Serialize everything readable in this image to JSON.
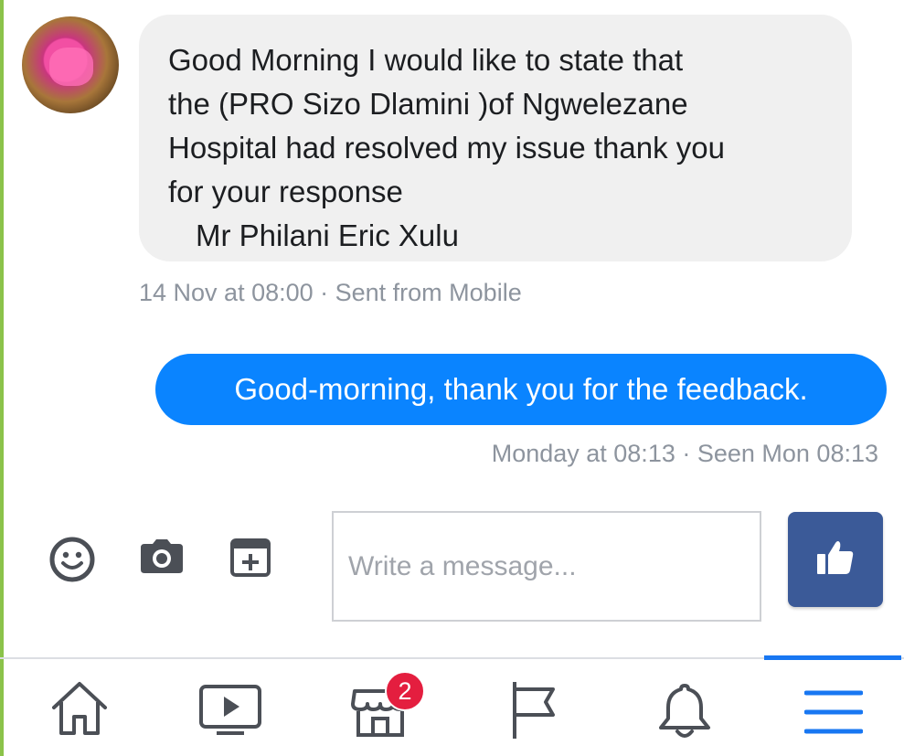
{
  "conversation": {
    "incoming": {
      "lines": [
        "Good Morning I would like to state that",
        "the (PRO Sizo Dlamini )of Ngwelezane",
        "Hospital had resolved my issue thank you",
        "for your response"
      ],
      "signature": "Mr Philani Eric Xulu",
      "meta": "14 Nov at 08:00 · Sent from Mobile"
    },
    "outgoing": {
      "text": "Good-morning, thank you for the feedback.",
      "meta": "Monday at 08:13 · Seen Mon 08:13"
    }
  },
  "composer": {
    "placeholder": "Write a message...",
    "icons": [
      "smiley-icon",
      "camera-icon",
      "add-sticker-icon"
    ],
    "send_icon": "thumbs-up-icon"
  },
  "bottom_nav": {
    "items": [
      "home-icon",
      "video-icon",
      "marketplace-icon",
      "pages-flag-icon",
      "notifications-bell-icon",
      "menu-icon"
    ],
    "marketplace_badge": "2",
    "active": "menu-icon",
    "accent_color": "#1877f2"
  },
  "colors": {
    "incoming_bubble": "#f0f0f0",
    "outgoing_bubble": "#0a84ff",
    "meta_text": "#8d949e",
    "like_button": "#3b5a98",
    "badge": "#e41e3f"
  }
}
